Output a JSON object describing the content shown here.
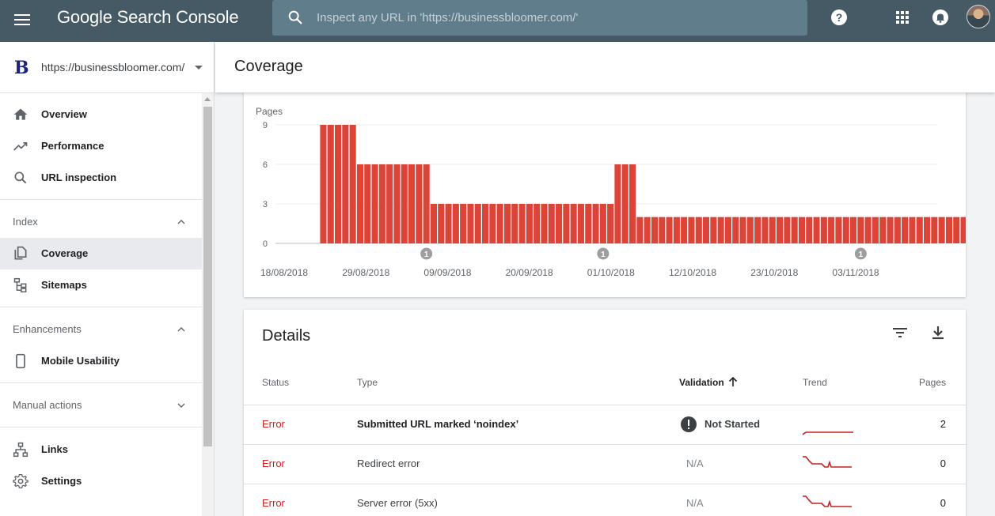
{
  "app": {
    "title": "Google Search Console",
    "search_placeholder": "Inspect any URL in 'https://businessbloomer.com/'"
  },
  "property": {
    "logo_letter": "B",
    "url": "https://businessbloomer.com/"
  },
  "sidebar": {
    "items": [
      {
        "label": "Overview",
        "icon": "home-icon"
      },
      {
        "label": "Performance",
        "icon": "trending-up-icon"
      },
      {
        "label": "URL inspection",
        "icon": "search-icon"
      }
    ],
    "sections": {
      "index": {
        "label": "Index",
        "expanded": true,
        "items": [
          {
            "label": "Coverage",
            "icon": "file-copy-icon",
            "active": true
          },
          {
            "label": "Sitemaps",
            "icon": "sitemap-icon"
          }
        ]
      },
      "enhancements": {
        "label": "Enhancements",
        "expanded": true,
        "items": [
          {
            "label": "Mobile Usability",
            "icon": "phone-icon"
          }
        ]
      },
      "manual_actions": {
        "label": "Manual actions",
        "expanded": false
      }
    },
    "bottom": [
      {
        "label": "Links",
        "icon": "links-icon"
      },
      {
        "label": "Settings",
        "icon": "gear-icon"
      }
    ]
  },
  "page": {
    "title": "Coverage"
  },
  "chart_data": {
    "type": "bar",
    "ylabel": "Pages",
    "yticks": [
      0,
      3,
      6,
      9
    ],
    "ylim": [
      0,
      9
    ],
    "color": "#db4437",
    "xtick_labels": [
      "18/08/2018",
      "29/08/2018",
      "09/09/2018",
      "20/09/2018",
      "01/10/2018",
      "12/10/2018",
      "23/10/2018",
      "03/11/2018"
    ],
    "start_date": "18/08/2018",
    "values": [
      0,
      0,
      0,
      0,
      0,
      0,
      9,
      9,
      9,
      9,
      9,
      6,
      6,
      6,
      6,
      6,
      6,
      6,
      6,
      6,
      6,
      3,
      3,
      3,
      3,
      3,
      3,
      3,
      3,
      3,
      3,
      3,
      3,
      3,
      3,
      3,
      3,
      3,
      3,
      3,
      3,
      3,
      3,
      3,
      3,
      3,
      6,
      6,
      6,
      2,
      2,
      2,
      2,
      2,
      2,
      2,
      2,
      2,
      2,
      2,
      2,
      2,
      2,
      2,
      2,
      2,
      2,
      2,
      2,
      2,
      2,
      2,
      2,
      2,
      2,
      2,
      2,
      2,
      2,
      2,
      2,
      2,
      2,
      2,
      2,
      2,
      2,
      2,
      2,
      2,
      2,
      2,
      2,
      2,
      2
    ],
    "annotations": [
      {
        "label": "1",
        "date": "07/09/2018"
      },
      {
        "label": "1",
        "date": "01/10/2018"
      },
      {
        "label": "1",
        "date": "05/11/2018"
      }
    ]
  },
  "details": {
    "title": "Details",
    "columns": {
      "status": "Status",
      "type": "Type",
      "validation": "Validation",
      "trend": "Trend",
      "pages": "Pages"
    },
    "rows": [
      {
        "status": "Error",
        "type": "Submitted URL marked ‘noindex’",
        "validation": "Not Started",
        "pages": "2"
      },
      {
        "status": "Error",
        "type": "Redirect error",
        "validation": "N/A",
        "pages": "0"
      },
      {
        "status": "Error",
        "type": "Server error (5xx)",
        "validation": "N/A",
        "pages": "0"
      }
    ],
    "colors": {
      "error": "#c5221f",
      "trend": "#c5221f"
    }
  }
}
